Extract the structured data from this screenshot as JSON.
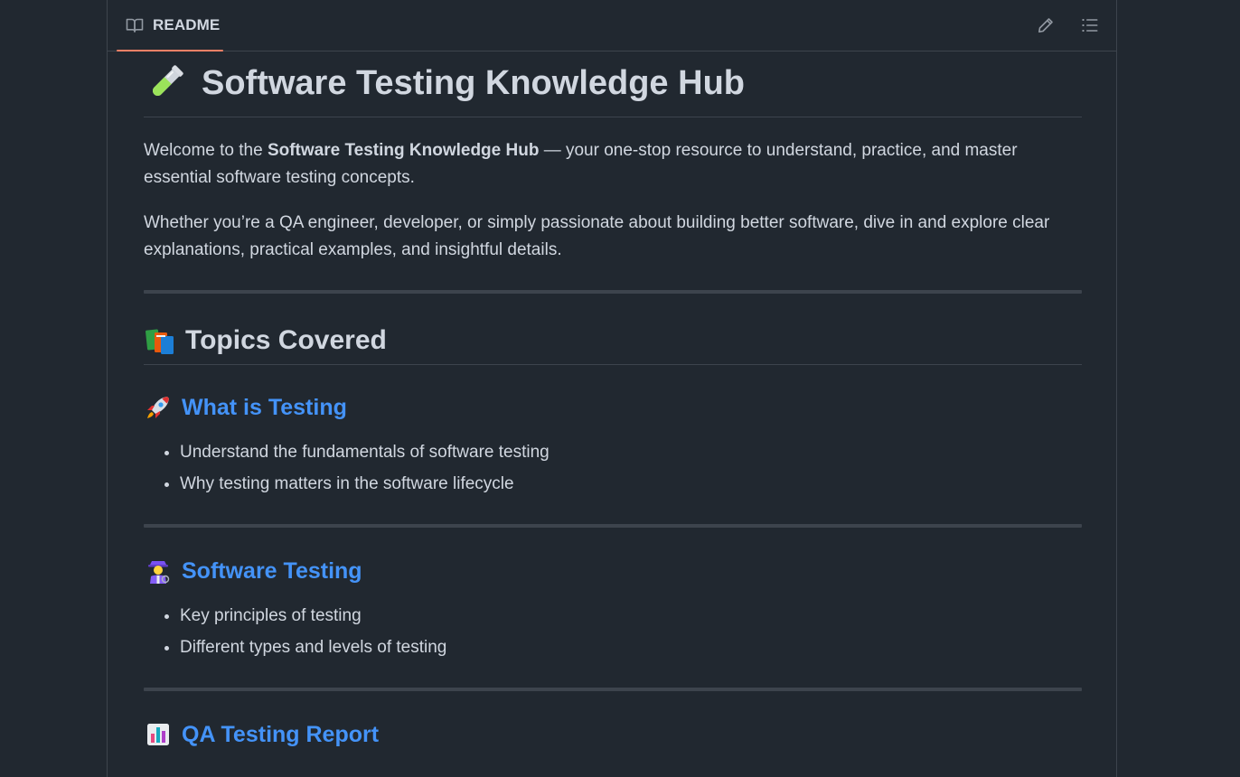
{
  "header": {
    "tab_label": "README",
    "edit_icon": "pencil-icon",
    "outline_icon": "list-unordered-icon",
    "accent": "#f78166"
  },
  "readme": {
    "title_emoji": "test-tube-icon",
    "title": "Software Testing Knowledge Hub",
    "intro": {
      "prefix": "Welcome to the ",
      "bold": "Software Testing Knowledge Hub",
      "suffix": " — your one-stop resource to understand, practice, and master essential software testing concepts."
    },
    "paragraph2": "Whether you’re a QA engineer, developer, or simply passionate about building better software, dive in and explore clear explanations, practical examples, and insightful details.",
    "topics_heading_emoji": "books-icon",
    "topics_heading": "Topics Covered",
    "sections": [
      {
        "emoji": "rocket-icon",
        "title": "What is Testing",
        "items": [
          "Understand the fundamentals of software testing",
          "Why testing matters in the software lifecycle"
        ]
      },
      {
        "emoji": "detective-icon",
        "title": "Software Testing",
        "items": [
          "Key principles of testing",
          "Different types and levels of testing"
        ]
      },
      {
        "emoji": "bar-chart-icon",
        "title": "QA Testing Report",
        "items": []
      }
    ]
  },
  "colors": {
    "background": "#212830",
    "text": "#d1d7e0",
    "link": "#4493f8",
    "border": "#3d444d"
  }
}
